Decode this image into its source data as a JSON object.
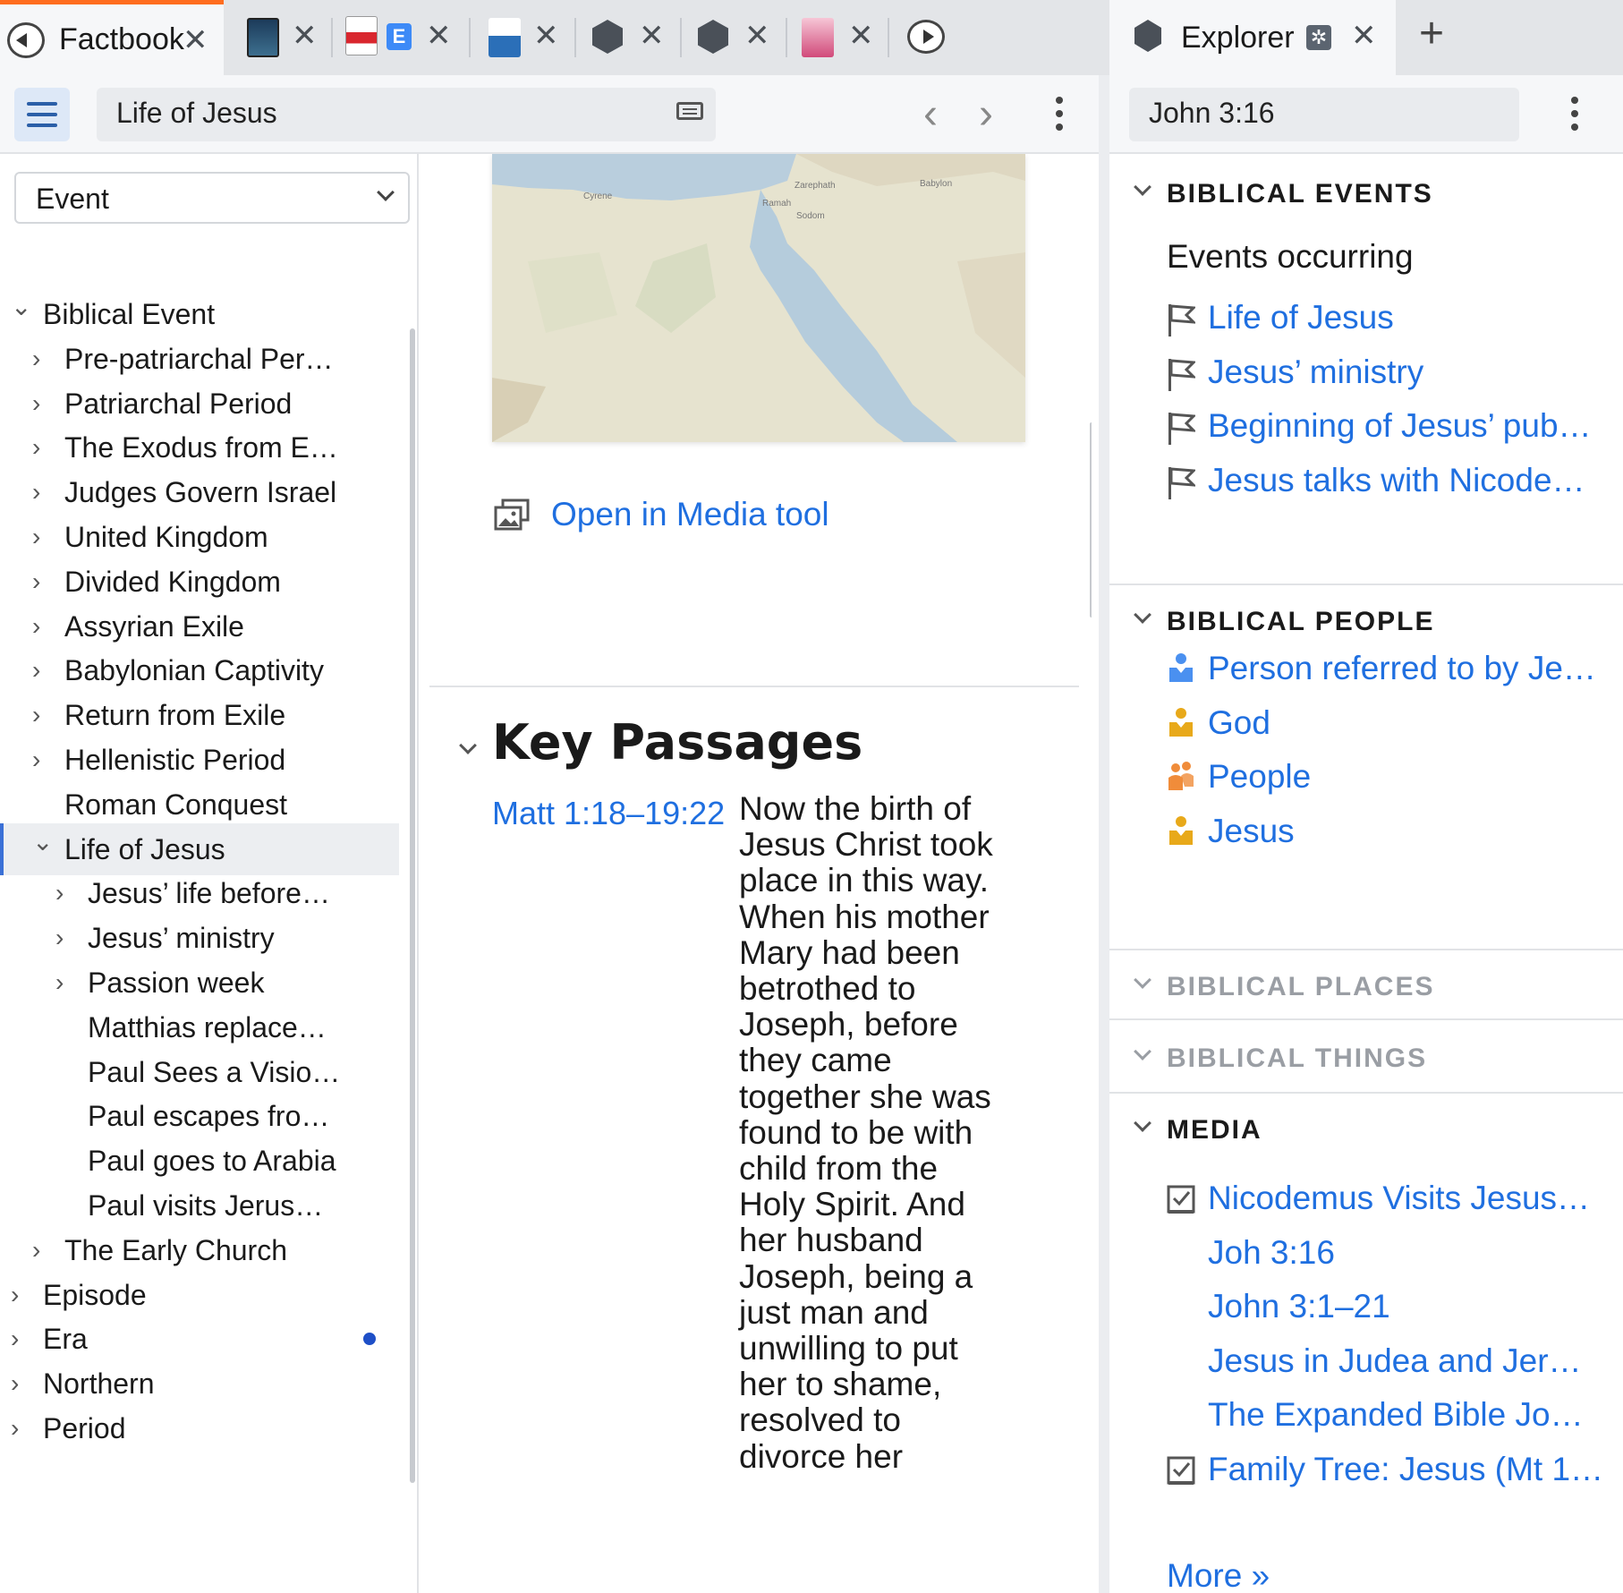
{
  "tabs": {
    "factbook_label": "Factbook",
    "explorer_label": "Explorer",
    "add_label": "+"
  },
  "left_toolbar": {
    "search_value": "Life of Jesus",
    "back_arrow": "‹",
    "forward_arrow": "›"
  },
  "right_toolbar": {
    "search_value": "John 3:16"
  },
  "tree": {
    "filter_value": "Event",
    "rows": [
      {
        "label": "Biblical Event",
        "arrow": "⌄",
        "indent": 0
      },
      {
        "label": "Pre-patriarchal Per…",
        "arrow": "›",
        "indent": 1
      },
      {
        "label": "Patriarchal Period",
        "arrow": "›",
        "indent": 1
      },
      {
        "label": "The Exodus from E…",
        "arrow": "›",
        "indent": 1
      },
      {
        "label": "Judges Govern Israel",
        "arrow": "›",
        "indent": 1
      },
      {
        "label": "United Kingdom",
        "arrow": "›",
        "indent": 1
      },
      {
        "label": "Divided Kingdom",
        "arrow": "›",
        "indent": 1
      },
      {
        "label": "Assyrian Exile",
        "arrow": "›",
        "indent": 1
      },
      {
        "label": "Babylonian Captivity",
        "arrow": "›",
        "indent": 1
      },
      {
        "label": "Return from Exile",
        "arrow": "›",
        "indent": 1
      },
      {
        "label": "Hellenistic Period",
        "arrow": "›",
        "indent": 1
      },
      {
        "label": "Roman Conquest",
        "arrow": "",
        "indent": 1
      },
      {
        "label": "Life of Jesus",
        "arrow": "⌄",
        "indent": 1,
        "selected": true
      },
      {
        "label": "Jesus’ life before…",
        "arrow": "›",
        "indent": 2
      },
      {
        "label": "Jesus’ ministry",
        "arrow": "›",
        "indent": 2
      },
      {
        "label": "Passion week",
        "arrow": "›",
        "indent": 2
      },
      {
        "label": "Matthias replace…",
        "arrow": "",
        "indent": 2
      },
      {
        "label": "Paul Sees a Visio…",
        "arrow": "",
        "indent": 2
      },
      {
        "label": "Paul escapes fro…",
        "arrow": "",
        "indent": 2
      },
      {
        "label": "Paul goes to Arabia",
        "arrow": "",
        "indent": 2
      },
      {
        "label": "Paul visits Jerus…",
        "arrow": "",
        "indent": 2
      },
      {
        "label": "The Early Church",
        "arrow": "›",
        "indent": 1
      },
      {
        "label": "Episode",
        "arrow": "›",
        "indent": 0
      },
      {
        "label": "Era",
        "arrow": "›",
        "indent": 0,
        "dot": true
      },
      {
        "label": "Northern",
        "arrow": "›",
        "indent": 0
      },
      {
        "label": "Period",
        "arrow": "›",
        "indent": 0
      }
    ]
  },
  "article": {
    "map_labels": [
      "Cyrene",
      "Zarephath",
      "Babylon",
      "Ramah",
      "Sodom"
    ],
    "media_link": "Open in Media tool",
    "section_title": "Key Passages",
    "passage_ref": "Matt 1:18–19:22",
    "passage_text": "Now the birth of Jesus Christ took place in this way. When his mother Mary had been betrothed to Joseph, before they came together she was found to be with child from the Holy Spirit. And her husband Joseph, being a just man and unwilling to put her to shame, resolved to divorce her"
  },
  "explorer": {
    "events": {
      "heading": "BIBLICAL EVENTS",
      "subheading": "Events occurring",
      "items": [
        "Life of Jesus",
        "Jesus’ ministry",
        "Beginning of Jesus’ pub…",
        "Jesus talks with Nicode…"
      ]
    },
    "people": {
      "heading": "BIBLICAL PEOPLE",
      "items": [
        {
          "label": "Person referred to by Je…",
          "color": "#4a90f0"
        },
        {
          "label": "God",
          "color": "#e8a91a"
        },
        {
          "label": "People",
          "color": "#f08c3a"
        },
        {
          "label": "Jesus",
          "color": "#e8a91a"
        }
      ]
    },
    "places_heading": "BIBLICAL PLACES",
    "things_heading": "BIBLICAL THINGS",
    "media": {
      "heading": "MEDIA",
      "items": [
        {
          "label": "Nicodemus Visits Jesus…",
          "icon": "checkbox-icon"
        },
        {
          "label": "Joh 3:16",
          "icon": ""
        },
        {
          "label": "John 3:1–21",
          "icon": ""
        },
        {
          "label": "Jesus in Judea and Jer…",
          "icon": ""
        },
        {
          "label": "The Expanded Bible Jo…",
          "icon": ""
        },
        {
          "label": "Family Tree: Jesus (Mt 1…",
          "icon": "checkbox-icon"
        }
      ],
      "more": "More »"
    }
  },
  "colors": {
    "accent_tab": "#ff6d1f",
    "link": "#1f6fe0",
    "selected_row": "#eceef1"
  }
}
